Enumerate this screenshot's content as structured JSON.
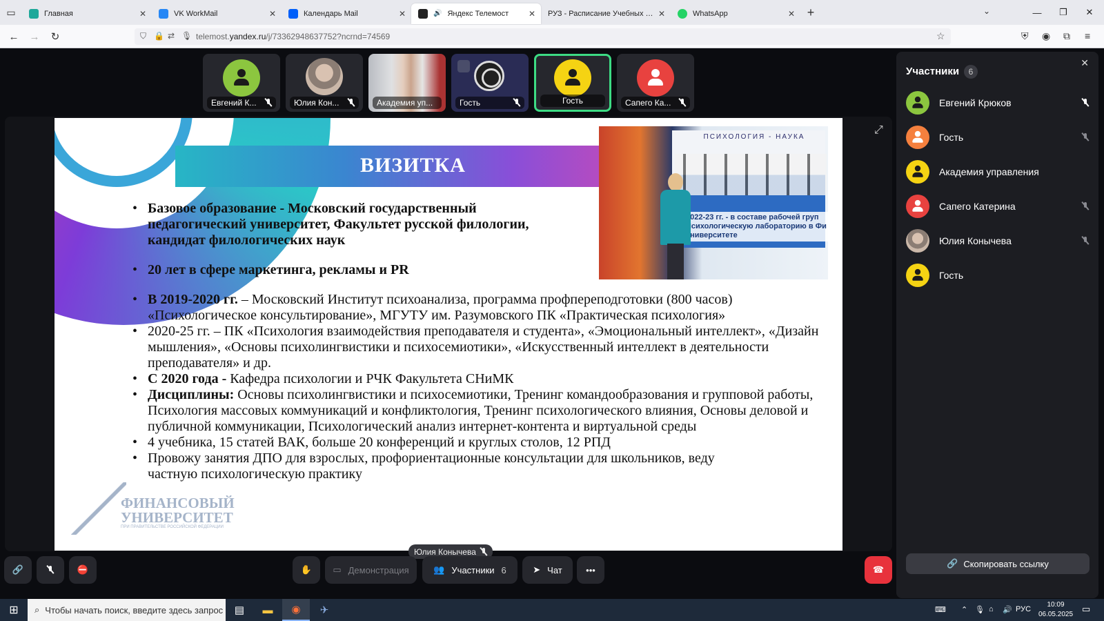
{
  "browser": {
    "tabs": [
      {
        "title": "Главная",
        "color": "#1fa89a"
      },
      {
        "title": "VK WorkMail",
        "color": "#2787f5"
      },
      {
        "title": "Календарь Mail",
        "color": "#005ff9"
      },
      {
        "title": "Яндекс Телемост",
        "color": "#222222",
        "active": true
      },
      {
        "title": "РУЗ - Расписание Учебных Заняти",
        "color": "#888888"
      },
      {
        "title": "WhatsApp",
        "color": "#25d366"
      }
    ],
    "url_prefix": "telemost.",
    "url_domain": "yandex.ru",
    "url_path": "/j/73362948637752?ncrnd=74569"
  },
  "tiles": [
    {
      "name": "Евгений К...",
      "color": "#8cc63f"
    },
    {
      "name": "Юлия Кон...",
      "color": "#9a8f88"
    },
    {
      "name": "Академия уп...",
      "color": "#c7b2a2"
    },
    {
      "name": "Гость",
      "color": "#202020"
    },
    {
      "name": "Гость",
      "color": "#f5d313",
      "speaking": true
    },
    {
      "name": "Сапего Ка...",
      "color": "#e8423f"
    }
  ],
  "slide": {
    "title": "ВИЗИТКА",
    "photo_header": "ПСИХОЛОГИЯ - НАУКА",
    "photo_caption_1": "2022-23 гг. - в составе рабочей груп",
    "photo_caption_2": "Психологическую лабораторию в Фи",
    "photo_caption_3": "университете",
    "b1_bold": "Базовое образование - Московский государственный педагогический университет, Факультет русской филологии, кандидат филологических наук",
    "b2_bold": "20 лет в сфере маркетинга, рекламы и PR",
    "b3_bold": "В 2019-2020 гг.",
    "b3_text": " – Московский Институт психоанализа, программа профпереподготовки (800 часов) «Психологическое консультирование», МГУТУ им. Разумовского ПК «Практическая психология»",
    "b4_text": "2020-25 гг. – ПК «Психология взаимодействия преподавателя и студента», «Эмоциональный интеллект», «Дизайн мышления», «Основы психолингвистики и психосемиотики», «Искусственный интеллект в деятельности преподавателя» и др.",
    "b5_bold": "С 2020 года - ",
    "b5_text": "Кафедра психологии и РЧК Факультета СНиМК",
    "b6_bold": "Дисциплины: ",
    "b6_text": "Основы психолингвистики и психосемиотики, Тренинг командообразования и групповой работы, Психология массовых коммуникаций и конфликтология, Тренинг психологического влияния, Основы деловой и публичной коммуникации, Психологический анализ интернет-контента и виртуальной среды",
    "b7_text": "4 учебника, 15 статей ВАК, больше 20 конференций и круглых столов, 12 РПД",
    "b8_text": "Провожу занятия ДПО для взрослых, профориентационные консультации для школьников, веду частную психологическую практику",
    "logo_line1": "ФИНАНСОВЫЙ",
    "logo_line2": "УНИВЕРСИТЕТ",
    "logo_line3": "ПРИ ПРАВИТЕЛЬСТВЕ РОССИЙСКОЙ ФЕДЕРАЦИИ"
  },
  "speaker_badge": "Юлия Конычева",
  "controls": {
    "demo_label": "Демонстрация",
    "participants_label": "Участники",
    "participants_count": "6",
    "chat_label": "Чат"
  },
  "panel": {
    "title": "Участники",
    "count": "6",
    "participants": [
      {
        "name": "Евгений Крюков",
        "color": "#8cc63f",
        "muted": true
      },
      {
        "name": "Гость",
        "color": "#f5803e",
        "muted": true
      },
      {
        "name": "Академия управления",
        "color": "#f5d313",
        "muted": false
      },
      {
        "name": "Сапего Катерина",
        "color": "#e8423f",
        "muted": true
      },
      {
        "name": "Юлия Конычева",
        "color": "#9a8f88",
        "muted": true
      },
      {
        "name": "Гость",
        "color": "#f5d313",
        "muted": false
      }
    ],
    "copy_link": "Скопировать ссылку"
  },
  "taskbar": {
    "search_placeholder": "Чтобы начать поиск, введите здесь запрос",
    "lang": "РУС",
    "time": "10:09",
    "date": "06.05.2025"
  }
}
